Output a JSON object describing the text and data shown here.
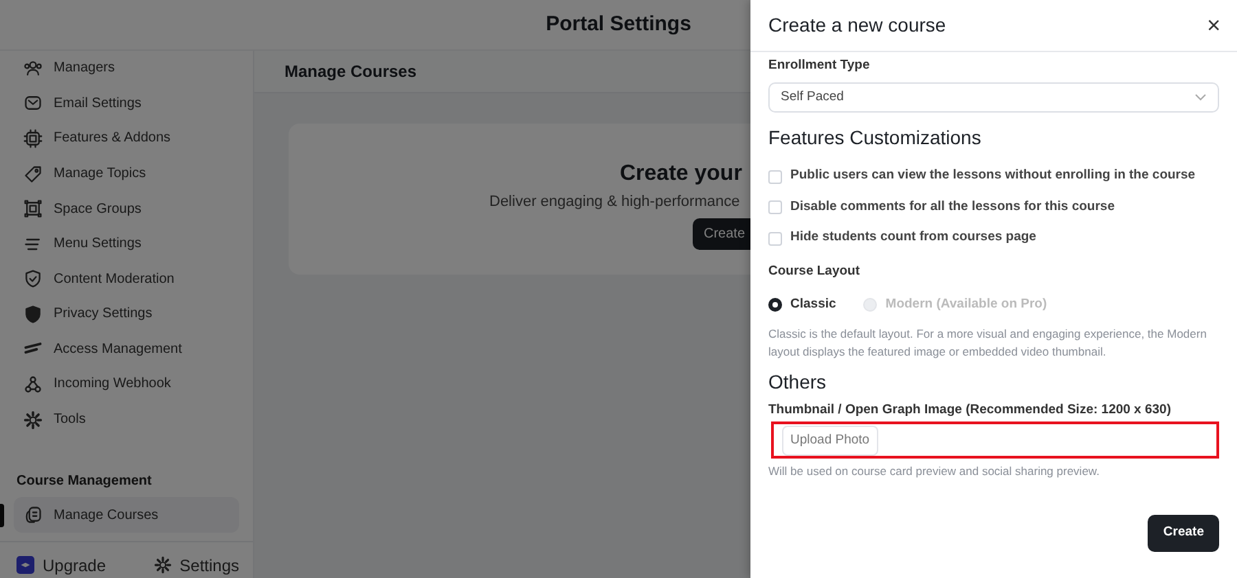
{
  "top_bar": {
    "title": "Portal Settings"
  },
  "sidebar": {
    "items": [
      {
        "label": "Managers",
        "selected": false
      },
      {
        "label": "Email Settings",
        "selected": false
      },
      {
        "label": "Features & Addons",
        "selected": false
      },
      {
        "label": "Manage Topics",
        "selected": false
      },
      {
        "label": "Space Groups",
        "selected": false
      },
      {
        "label": "Menu Settings",
        "selected": false
      },
      {
        "label": "Content Moderation",
        "selected": false
      },
      {
        "label": "Privacy Settings",
        "selected": false
      },
      {
        "label": "Access Management",
        "selected": false
      },
      {
        "label": "Incoming Webhook",
        "selected": false
      },
      {
        "label": "Tools",
        "selected": false
      }
    ],
    "section": {
      "title": "Course Management",
      "items": [
        {
          "label": "Manage Courses",
          "selected": true
        }
      ]
    },
    "footer": {
      "upgrade": "Upgrade",
      "settings": "Settings"
    }
  },
  "main": {
    "title": "Manage Courses",
    "empty_state": {
      "title": "Create your",
      "subtitle": "Deliver engaging & high-performance",
      "button": "Create"
    }
  },
  "drawer": {
    "title": "Create a new course",
    "close": "×",
    "enrollment": {
      "label": "Enrollment Type",
      "value": "Self Paced"
    },
    "features": {
      "title": "Features Customizations",
      "options": [
        {
          "label": "Public users can view the lessons without enrolling in the course",
          "checked": false
        },
        {
          "label": "Disable comments for all the lessons for this course",
          "checked": false
        },
        {
          "label": "Hide students count from courses page",
          "checked": false
        }
      ]
    },
    "layout": {
      "label": "Course Layout",
      "options": [
        {
          "label": "Classic",
          "selected": true,
          "disabled": false
        },
        {
          "label": "Modern (Available on Pro)",
          "selected": false,
          "disabled": true
        }
      ],
      "help": "Classic is the default layout. For a more visual and engaging experience, the Modern layout displays the featured image or embedded video thumbnail."
    },
    "others": {
      "title": "Others",
      "label": "Thumbnail / Open Graph Image (Recommended Size: 1200 x 630)",
      "upload_button": "Upload Photo",
      "highlighted": true,
      "help": "Will be used on course card preview and social sharing preview."
    },
    "submit": "Create"
  }
}
